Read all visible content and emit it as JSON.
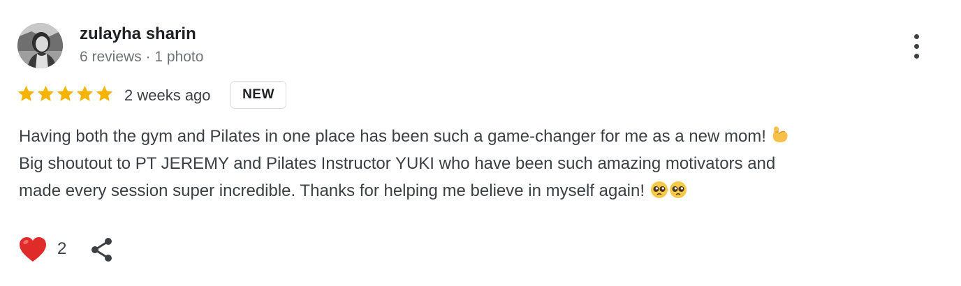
{
  "reviewer": {
    "name": "zulayha sharin",
    "meta": "6 reviews · 1 photo",
    "avatar_icon": "profile-photo"
  },
  "rating": {
    "stars": 5,
    "max_stars": 5,
    "star_color": "#f4b400",
    "date": "2 weeks ago",
    "badge": "NEW"
  },
  "review": {
    "lines": [
      "Having both the gym and Pilates in one place has been such a game-changer for me as a new mom!",
      "Big shoutout to PT JEREMY and Pilates Instructor YUKI who have been such amazing motivators and",
      "made every session super incredible. Thanks for helping me believe in myself again!"
    ],
    "emojis": [
      "flexed-biceps",
      "pleading-face",
      "pleading-face"
    ]
  },
  "actions": {
    "like_icon": "heart-icon",
    "like_count": "2",
    "share_icon": "share-icon",
    "more_icon": "more-vertical-icon",
    "heart_color": "#e02b2b"
  }
}
